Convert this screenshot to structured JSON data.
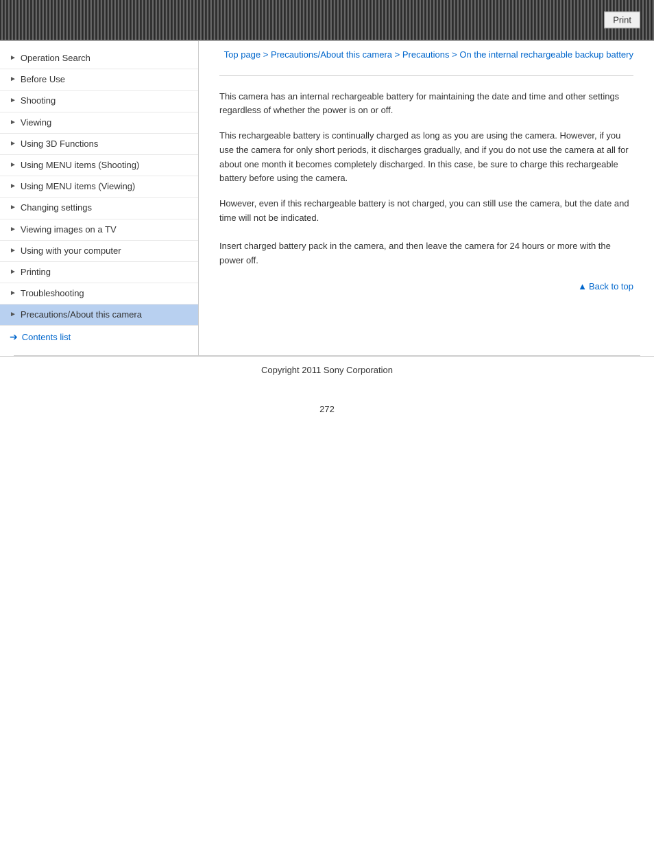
{
  "header": {
    "print_label": "Print"
  },
  "breadcrumb": {
    "top_page": "Top page",
    "separator1": " > ",
    "precautions_about": "Precautions/About this camera",
    "separator2": " > ",
    "precautions": "Precautions",
    "separator3": " > ",
    "current": "On the internal rechargeable backup battery"
  },
  "sidebar": {
    "items": [
      {
        "label": "Operation Search",
        "active": false
      },
      {
        "label": "Before Use",
        "active": false
      },
      {
        "label": "Shooting",
        "active": false
      },
      {
        "label": "Viewing",
        "active": false
      },
      {
        "label": "Using 3D Functions",
        "active": false
      },
      {
        "label": "Using MENU items (Shooting)",
        "active": false
      },
      {
        "label": "Using MENU items (Viewing)",
        "active": false
      },
      {
        "label": "Changing settings",
        "active": false
      },
      {
        "label": "Viewing images on a TV",
        "active": false
      },
      {
        "label": "Using with your computer",
        "active": false
      },
      {
        "label": "Printing",
        "active": false
      },
      {
        "label": "Troubleshooting",
        "active": false
      },
      {
        "label": "Precautions/About this camera",
        "active": true
      }
    ],
    "contents_list": "Contents list"
  },
  "content": {
    "paragraph1": "This camera has an internal rechargeable battery for maintaining the date and time and other settings regardless of whether the power is on or off.",
    "paragraph2": "This rechargeable battery is continually charged as long as you are using the camera. However, if you use the camera for only short periods, it discharges gradually, and if you do not use the camera at all for about one month it becomes completely discharged. In this case, be sure to charge this rechargeable battery before using the camera.",
    "paragraph3": "However, even if this rechargeable battery is not charged, you can still use the camera, but the date and time will not be indicated.",
    "paragraph4": "Insert charged battery pack in the camera, and then leave the camera for 24 hours or more with the power off."
  },
  "back_to_top": "Back to top",
  "footer": {
    "copyright": "Copyright 2011 Sony Corporation"
  },
  "page_number": "272"
}
